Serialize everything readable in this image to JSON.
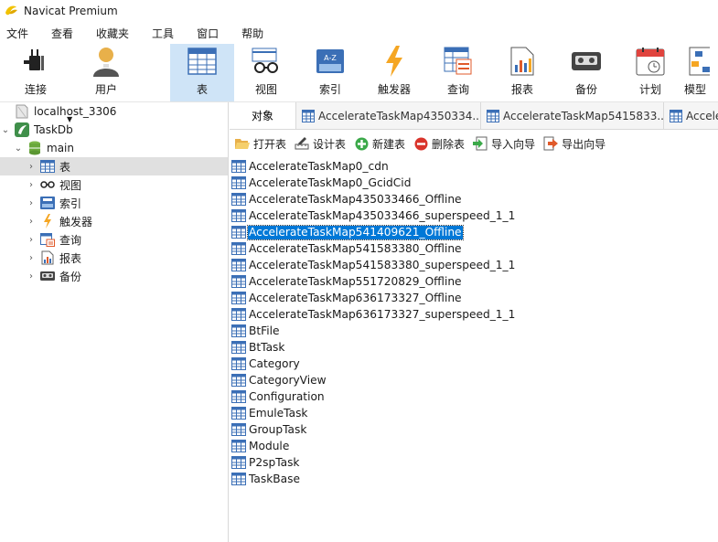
{
  "window": {
    "title": "Navicat Premium"
  },
  "menubar": {
    "items": [
      "文件",
      "查看",
      "收藏夹",
      "工具",
      "窗口",
      "帮助"
    ]
  },
  "toolbar": {
    "buttons": [
      {
        "label": "连接",
        "icon": "plug-icon"
      },
      {
        "label": "用户",
        "icon": "user-icon"
      },
      {
        "label": "表",
        "icon": "table-icon",
        "active": true
      },
      {
        "label": "视图",
        "icon": "glasses-icon"
      },
      {
        "label": "索引",
        "icon": "index-icon"
      },
      {
        "label": "触发器",
        "icon": "lightning-icon"
      },
      {
        "label": "查询",
        "icon": "query-icon"
      },
      {
        "label": "报表",
        "icon": "report-icon"
      },
      {
        "label": "备份",
        "icon": "backup-icon"
      },
      {
        "label": "计划",
        "icon": "calendar-icon"
      },
      {
        "label": "模型",
        "icon": "model-icon"
      }
    ]
  },
  "sidebar": {
    "connection": "localhost_3306",
    "database": "TaskDb",
    "schema": "main",
    "items": [
      {
        "label": "表",
        "icon": "table-icon",
        "selected": true
      },
      {
        "label": "视图",
        "icon": "glasses-icon"
      },
      {
        "label": "索引",
        "icon": "index-icon"
      },
      {
        "label": "触发器",
        "icon": "lightning-icon"
      },
      {
        "label": "查询",
        "icon": "query-icon"
      },
      {
        "label": "报表",
        "icon": "report-icon"
      },
      {
        "label": "备份",
        "icon": "backup-icon"
      }
    ]
  },
  "tabs": {
    "objects": "对象",
    "open": [
      "AccelerateTaskMap4350334...",
      "AccelerateTaskMap5415833...",
      "Accele"
    ]
  },
  "actions": [
    "打开表",
    "设计表",
    "新建表",
    "删除表",
    "导入向导",
    "导出向导"
  ],
  "tables": [
    "AccelerateTaskMap0_cdn",
    "AccelerateTaskMap0_GcidCid",
    "AccelerateTaskMap435033466_Offline",
    "AccelerateTaskMap435033466_superspeed_1_1",
    "AccelerateTaskMap541409621_Offline",
    "AccelerateTaskMap541583380_Offline",
    "AccelerateTaskMap541583380_superspeed_1_1",
    "AccelerateTaskMap551720829_Offline",
    "AccelerateTaskMap636173327_Offline",
    "AccelerateTaskMap636173327_superspeed_1_1",
    "BtFile",
    "BtTask",
    "Category",
    "CategoryView",
    "Configuration",
    "EmuleTask",
    "GroupTask",
    "Module",
    "P2spTask",
    "TaskBase"
  ],
  "selected_table": "AccelerateTaskMap541409621_Offline",
  "colors": {
    "selection": "#0078d7",
    "toolbar_active": "#cfe4f7",
    "sidebar_selected": "#e0e0e0"
  }
}
